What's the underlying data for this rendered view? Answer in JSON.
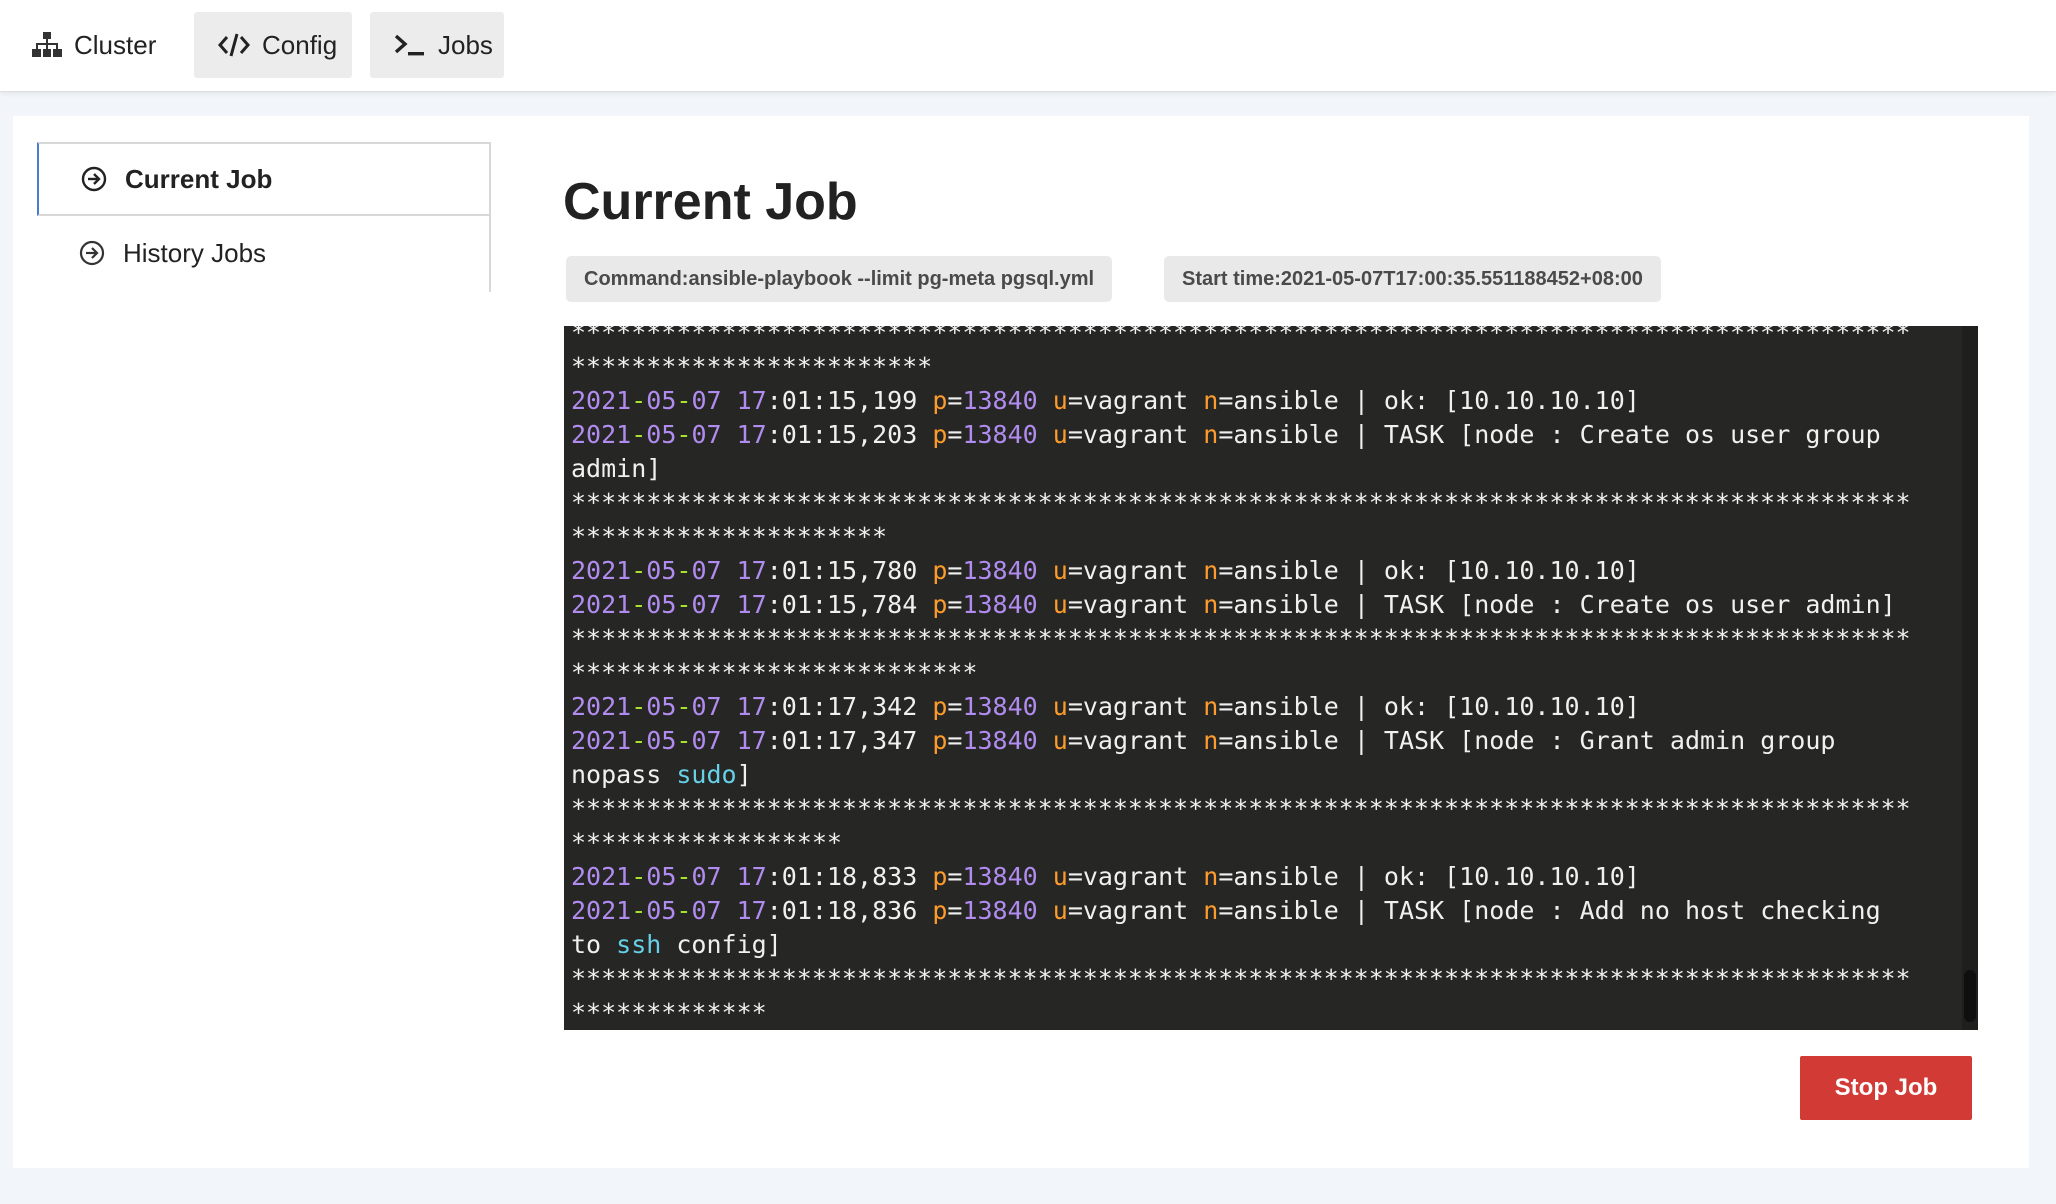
{
  "nav": {
    "items": [
      {
        "label": "Cluster",
        "icon": "sitemap-icon"
      },
      {
        "label": "Config",
        "icon": "code-icon"
      },
      {
        "label": "Jobs",
        "icon": "terminal-icon"
      }
    ]
  },
  "sidebar": {
    "items": [
      {
        "label": "Current Job",
        "icon": "arrow-circle-right-icon",
        "active": true
      },
      {
        "label": "History Jobs",
        "icon": "arrow-circle-right-icon",
        "active": false
      }
    ]
  },
  "main": {
    "title": "Current Job",
    "command_tag": "Command:ansible-playbook --limit pg-meta pgsql.yml",
    "start_time_tag": "Start time:2021-05-07T17:00:35.551188452+08:00",
    "stop_button": "Stop Job"
  },
  "log": {
    "separator_full": "*****************************************************************************************",
    "lines": [
      {
        "type": "sep",
        "text": "*****************************************************************************************"
      },
      {
        "type": "sep",
        "text": "************************"
      },
      {
        "type": "entry",
        "date": "2021-05-07",
        "time": "17:01:15,199",
        "pid": "13840",
        "user": "vagrant",
        "name": "ansible",
        "msg": "ok: [10.10.10.10]"
      },
      {
        "type": "entry",
        "date": "2021-05-07",
        "time": "17:01:15,203",
        "pid": "13840",
        "user": "vagrant",
        "name": "ansible",
        "msg": "TASK [node : Create os user group"
      },
      {
        "type": "text",
        "text": "admin]"
      },
      {
        "type": "sep",
        "text": "*****************************************************************************************"
      },
      {
        "type": "sep",
        "text": "*********************"
      },
      {
        "type": "entry",
        "date": "2021-05-07",
        "time": "17:01:15,780",
        "pid": "13840",
        "user": "vagrant",
        "name": "ansible",
        "msg": "ok: [10.10.10.10]"
      },
      {
        "type": "entry",
        "date": "2021-05-07",
        "time": "17:01:15,784",
        "pid": "13840",
        "user": "vagrant",
        "name": "ansible",
        "msg": "TASK [node : Create os user admin]"
      },
      {
        "type": "sep",
        "text": "*****************************************************************************************"
      },
      {
        "type": "sep",
        "text": "***************************"
      },
      {
        "type": "entry",
        "date": "2021-05-07",
        "time": "17:01:17,342",
        "pid": "13840",
        "user": "vagrant",
        "name": "ansible",
        "msg": "ok: [10.10.10.10]"
      },
      {
        "type": "entry",
        "date": "2021-05-07",
        "time": "17:01:17,347",
        "pid": "13840",
        "user": "vagrant",
        "name": "ansible",
        "msg": "TASK [node : Grant admin group"
      },
      {
        "type": "text",
        "text": "nopass ",
        "kw": "sudo",
        "after": "]"
      },
      {
        "type": "sep",
        "text": "*****************************************************************************************"
      },
      {
        "type": "sep",
        "text": "******************"
      },
      {
        "type": "entry",
        "date": "2021-05-07",
        "time": "17:01:18,833",
        "pid": "13840",
        "user": "vagrant",
        "name": "ansible",
        "msg": "ok: [10.10.10.10]"
      },
      {
        "type": "entry",
        "date": "2021-05-07",
        "time": "17:01:18,836",
        "pid": "13840",
        "user": "vagrant",
        "name": "ansible",
        "msg": "TASK [node : Add no host checking"
      },
      {
        "type": "text",
        "text": "to ",
        "kw": "ssh",
        "after": " config]"
      },
      {
        "type": "sep",
        "text": "*****************************************************************************************"
      },
      {
        "type": "sep",
        "text": "*************"
      }
    ]
  }
}
